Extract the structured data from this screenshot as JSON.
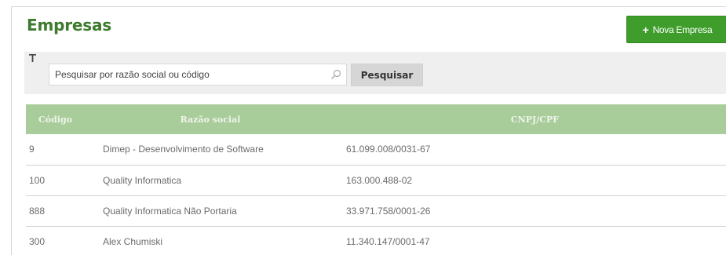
{
  "page": {
    "title": "Empresas",
    "new_button_label": "Nova Empresa",
    "new_button_icon": "plus-icon"
  },
  "filter": {
    "filter_icon": "filter-icon",
    "search_placeholder": "Pesquisar por razão social ou código",
    "search_value": "",
    "search_icon": "search-icon",
    "search_button_label": "Pesquisar"
  },
  "table": {
    "headers": [
      "Código",
      "Razão social",
      "CNPJ/CPF"
    ],
    "rows": [
      {
        "code": "9",
        "name": "Dimep - Desenvolvimento de Software",
        "cnpj": "61.099.008/0031-67"
      },
      {
        "code": "100",
        "name": "Quality Informatica",
        "cnpj": "163.000.488-02"
      },
      {
        "code": "888",
        "name": "Quality Informatica Não Portaria",
        "cnpj": "33.971.758/0001-26"
      },
      {
        "code": "300",
        "name": "Alex Chumiski",
        "cnpj": "11.340.147/0001-47"
      }
    ]
  },
  "colors": {
    "title": "#3d7a2e",
    "primary_button": "#3f9d2b",
    "table_header": "#a9cc9b",
    "filter_bar": "#efefef",
    "search_button": "#d6d6d6"
  }
}
